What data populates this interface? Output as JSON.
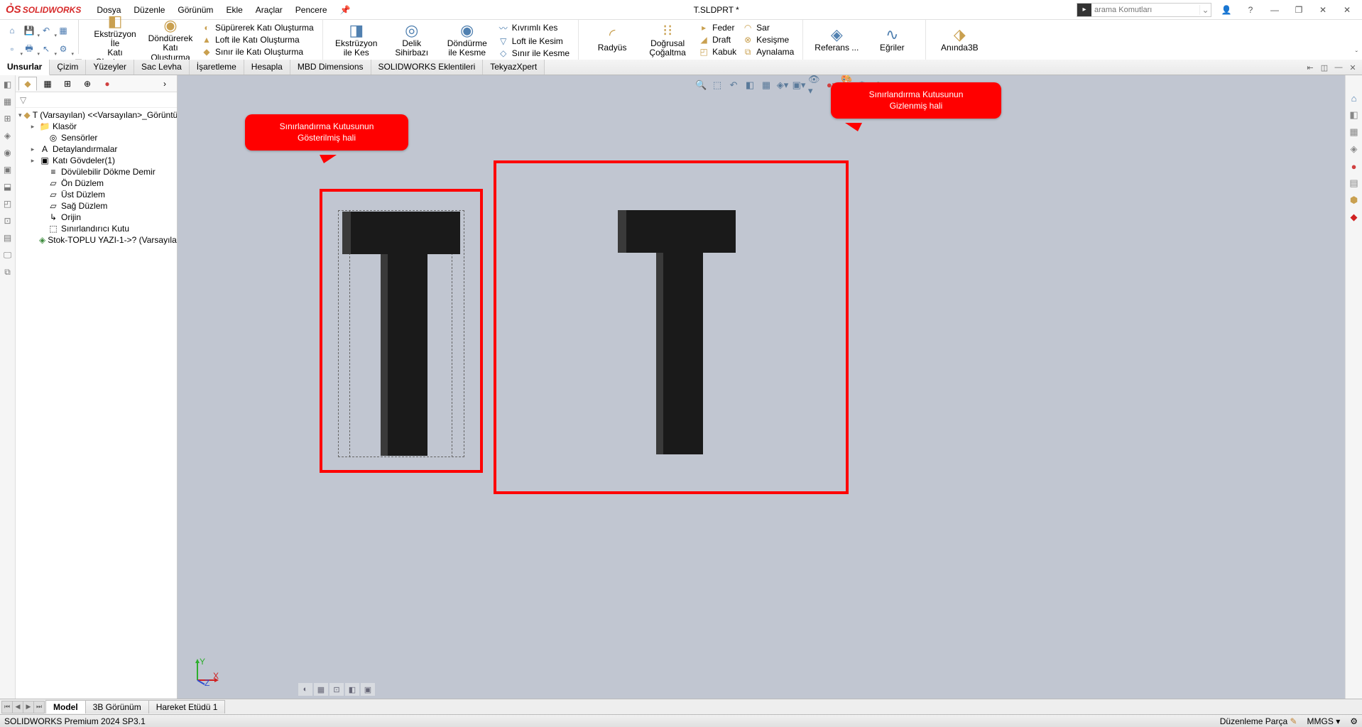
{
  "app": {
    "logo_text": "SOLIDWORKS",
    "title": "T.SLDPRT *"
  },
  "menu": [
    "Dosya",
    "Düzenle",
    "Görünüm",
    "Ekle",
    "Araçlar",
    "Pencere"
  ],
  "search": {
    "placeholder": "arama Komutları"
  },
  "ribbon": {
    "big": [
      {
        "label1": "Ekstrüzyon İle",
        "label2": "Katı Oluşturma"
      },
      {
        "label1": "Döndürerek",
        "label2": "Katı Oluşturma"
      }
    ],
    "col1": [
      "Süpürerek Katı Oluşturma",
      "Loft ile Katı Oluşturma",
      "Sınır ile Katı Oluşturma"
    ],
    "big2": [
      {
        "label1": "Ekstrüzyon",
        "label2": "ile Kes"
      },
      {
        "label1": "Delik Sihirbazı",
        "label2": ""
      },
      {
        "label1": "Döndürme",
        "label2": "ile Kesme"
      }
    ],
    "col2": [
      "Kıvrımlı Kes",
      "Loft ile Kesim",
      "Sınır ile Kesme"
    ],
    "big3": [
      {
        "label1": "Radyüs",
        "label2": ""
      },
      {
        "label1": "Doğrusal Çoğaltma",
        "label2": ""
      }
    ],
    "col3a": [
      "Feder",
      "Draft",
      "Kabuk"
    ],
    "col3b": [
      "Sar",
      "Kesişme",
      "Aynalama"
    ],
    "big4": [
      {
        "label1": "Referans ...",
        "label2": ""
      },
      {
        "label1": "Eğriler",
        "label2": ""
      },
      {
        "label1": "Anında3B",
        "label2": ""
      }
    ]
  },
  "tabs": [
    "Unsurlar",
    "Çizim",
    "Yüzeyler",
    "Sac Levha",
    "İşaretleme",
    "Hesapla",
    "MBD Dimensions",
    "SOLIDWORKS Eklentileri",
    "TekyazXpert"
  ],
  "tree": {
    "root": "T (Varsayılan) <<Varsayılan>_Görüntü",
    "items": [
      "Klasör",
      "Sensörler",
      "Detaylandırmalar",
      "Katı Gövdeler(1)",
      "Dövülebilir Dökme Demir",
      "Ön Düzlem",
      "Üst Düzlem",
      "Sağ Düzlem",
      "Orijin",
      "Sınırlandırıcı Kutu",
      "Stok-TOPLU YAZI-1->? (Varsayıla"
    ]
  },
  "callouts": {
    "c1a": "Sınırlandırma Kutusunun",
    "c1b": "Gösterilmiş hali",
    "c2a": "Sınırlandırma Kutusunun",
    "c2b": "Gizlenmiş hali"
  },
  "bottom_tabs": [
    "Model",
    "3B Görünüm",
    "Hareket Etüdü 1"
  ],
  "status": {
    "left": "SOLIDWORKS Premium 2024 SP3.1",
    "r1": "Düzenleme Parça",
    "r2": "MMGS"
  }
}
